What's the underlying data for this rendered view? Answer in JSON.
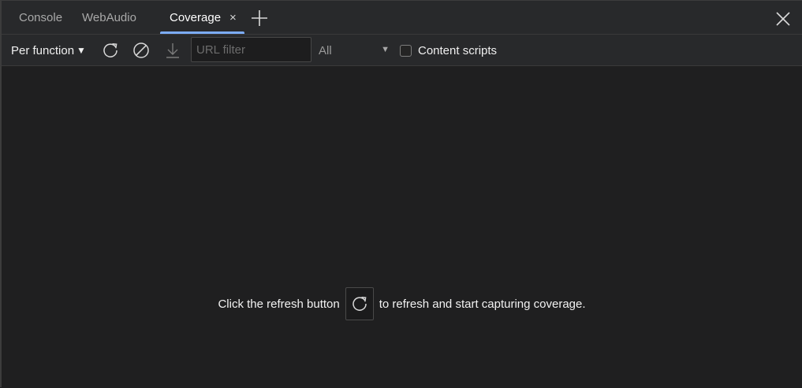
{
  "tabs": [
    {
      "label": "Console",
      "active": false
    },
    {
      "label": "WebAudio",
      "active": false
    },
    {
      "label": "Coverage",
      "active": true,
      "close_symbol": "×"
    }
  ],
  "tabbar": {
    "add_icon": "plus-icon",
    "close_icon": "close-icon"
  },
  "toolbar": {
    "mode_label": "Per function",
    "mode_caret": "▼",
    "reload_icon": "reload-icon",
    "clear_icon": "clear-icon",
    "export_icon": "download-icon",
    "url_filter_placeholder": "URL filter",
    "url_filter_value": "",
    "type_filter_value": "All",
    "type_caret": "▼",
    "content_scripts_label": "Content scripts",
    "content_scripts_checked": false
  },
  "main": {
    "message_before": "Click the refresh button",
    "message_after": "to refresh and start capturing coverage.",
    "refresh_icon": "reload-icon"
  },
  "colors": {
    "accent": "#7cacf8",
    "background": "#1f1f20",
    "toolbar": "#28292b"
  }
}
